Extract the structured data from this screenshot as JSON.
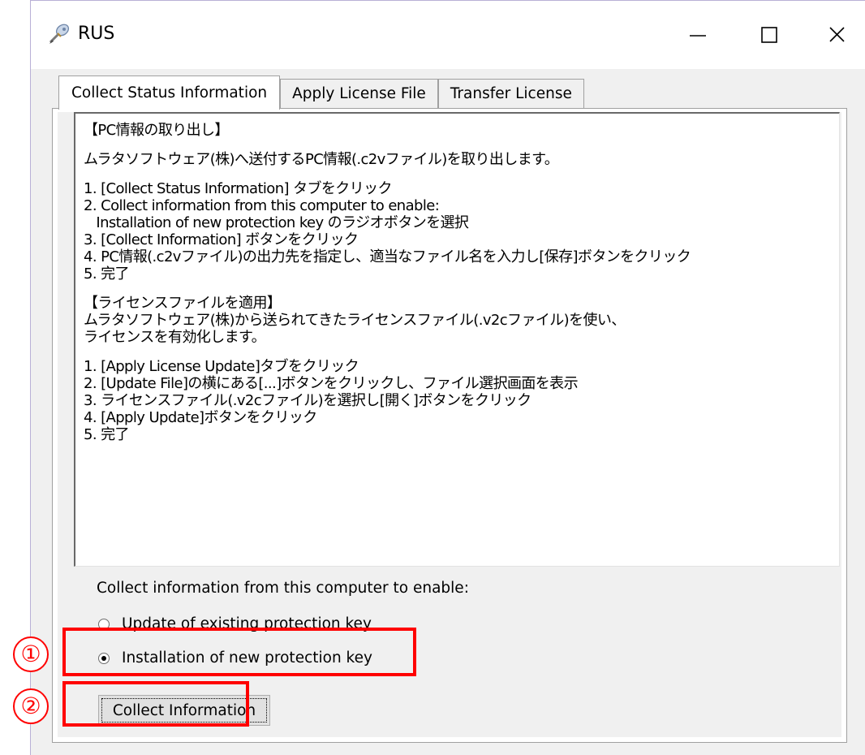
{
  "window": {
    "title": "RUS",
    "app_icon": "key-pen-icon",
    "controls": {
      "minimize_icon": "minimize-icon",
      "maximize_icon": "maximize-icon",
      "close_icon": "close-icon"
    }
  },
  "tabs": [
    {
      "label": "Collect Status Information",
      "active": true
    },
    {
      "label": "Apply License File",
      "active": false
    },
    {
      "label": "Transfer License",
      "active": false
    }
  ],
  "instructions": {
    "lines": [
      "【PC情報の取り出し】",
      "",
      "ムラタソフトウェア(株)へ送付するPC情報(.c2vファイル)を取り出します。",
      "",
      "1. [Collect Status Information] タブをクリック",
      "2. Collect information from this computer to enable:",
      "   Installation of new protection key のラジオボタンを選択",
      "3. [Collect Information] ボタンをクリック",
      "4. PC情報(.c2vファイル)の出力先を指定し、適当なファイル名を入力し[保存]ボタンをクリック",
      "5. 完了",
      "",
      "【ライセンスファイルを適用】",
      "ムラタソフトウェア(株)から送られてきたライセンスファイル(.v2cファイル)を使い、",
      "ライセンスを有効化します。",
      "",
      "1. [Apply License Update]タブをクリック",
      "2. [Update File]の横にある[...]ボタンをクリックし、ファイル選択画面を表示",
      "3. ライセンスファイル(.v2cファイル)を選択し[開く]ボタンをクリック",
      "4. [Apply Update]ボタンをクリック",
      "5. 完了"
    ]
  },
  "collect_group": {
    "label": "Collect information from this computer to enable:",
    "options": [
      {
        "label": "Update of existing protection key",
        "selected": false
      },
      {
        "label": "Installation of new protection key",
        "selected": true
      }
    ],
    "button_label": "Collect Information"
  },
  "annotations": {
    "marker_1": "①",
    "marker_2": "②",
    "highlight_color": "#ff0000"
  }
}
